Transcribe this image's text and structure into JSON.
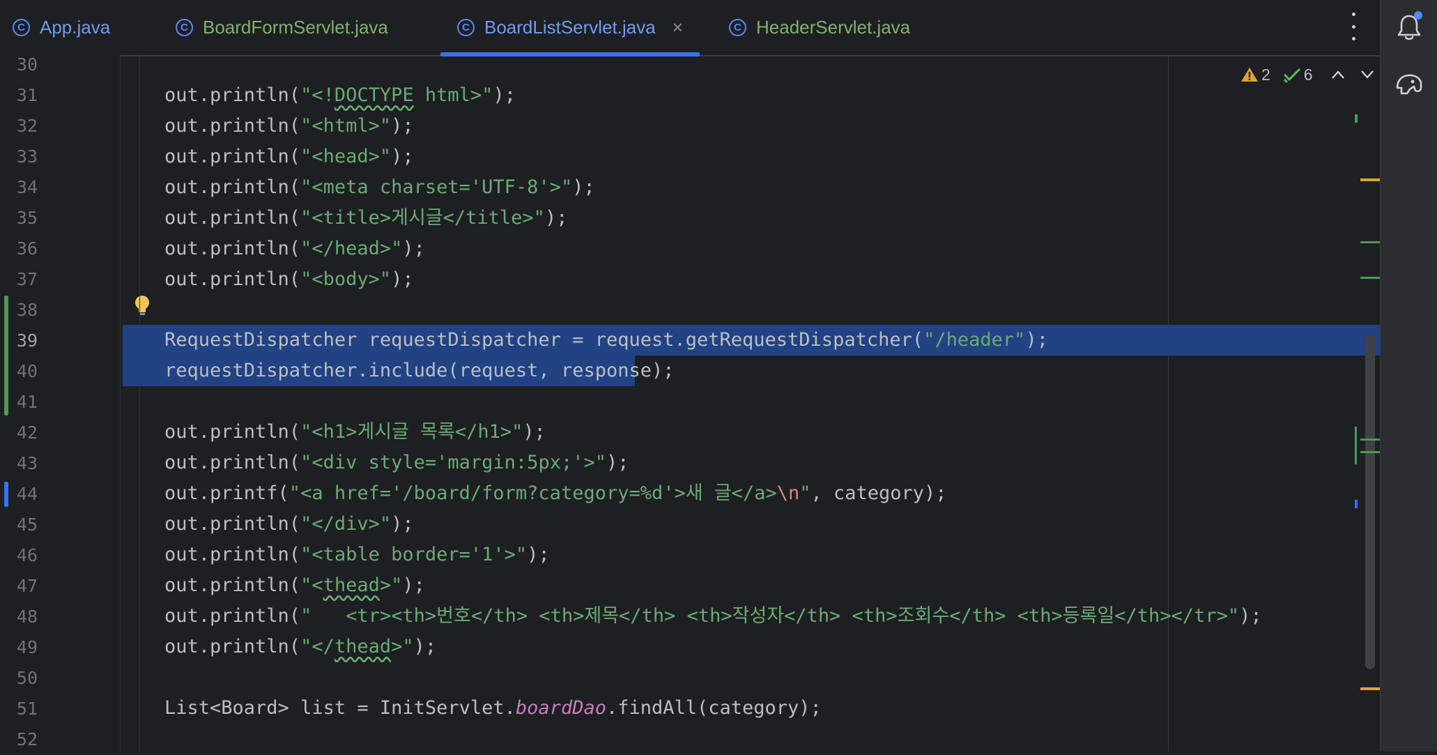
{
  "tabs": [
    {
      "label": "App.java",
      "icon": "java-class-icon",
      "color": "#6f9cf0",
      "active": false,
      "closable": false
    },
    {
      "label": "BoardFormServlet.java",
      "icon": "java-class-icon",
      "color": "#7fb36a",
      "active": false,
      "closable": false
    },
    {
      "label": "BoardListServlet.java",
      "icon": "java-class-icon",
      "color": "#6f9cf0",
      "active": true,
      "closable": true
    },
    {
      "label": "HeaderServlet.java",
      "icon": "java-class-icon",
      "color": "#7fb36a",
      "active": false,
      "closable": false
    }
  ],
  "tab_close_glyph": "×",
  "inspections": {
    "warnings": "2",
    "passed": "6"
  },
  "line_numbers": [
    "30",
    "31",
    "32",
    "33",
    "34",
    "35",
    "36",
    "37",
    "38",
    "39",
    "40",
    "41",
    "42",
    "43",
    "44",
    "45",
    "46",
    "47",
    "48",
    "49",
    "50",
    "51",
    "52"
  ],
  "current_line": "39",
  "code": {
    "l31": {
      "pre": "out.println(",
      "str_a": "\"<!",
      "str_b": "DOCTYPE",
      "str_c": " html>\"",
      "post": ");"
    },
    "l32": {
      "pre": "out.println(",
      "str": "\"<html>\"",
      "post": ");"
    },
    "l33": {
      "pre": "out.println(",
      "str": "\"<head>\"",
      "post": ");"
    },
    "l34": {
      "pre": "out.println(",
      "str": "\"<meta charset='UTF-8'>\"",
      "post": ");"
    },
    "l35": {
      "pre": "out.println(",
      "str": "\"<title>게시글</title>\"",
      "post": ");"
    },
    "l36": {
      "pre": "out.println(",
      "str": "\"</head>\"",
      "post": ");"
    },
    "l37": {
      "pre": "out.println(",
      "str": "\"<body>\"",
      "post": ");"
    },
    "l39": {
      "pre": "RequestDispatcher requestDispatcher = request.getRequestDispatcher(",
      "str": "\"/header\"",
      "post": ");"
    },
    "l40": {
      "text": "requestDispatcher.include(request, response);"
    },
    "l42": {
      "pre": "out.println(",
      "str": "\"<h1>게시글 목록</h1>\"",
      "post": ");"
    },
    "l43": {
      "pre": "out.println(",
      "str": "\"<div style='margin:5px;'>\"",
      "post": ");"
    },
    "l44": {
      "pre": "out.printf(",
      "str": "\"<a href='/board/form?category=%d'>새 글</a>",
      "esc": "\\n",
      "str_end": "\"",
      "post": ", category);"
    },
    "l45": {
      "pre": "out.println(",
      "str": "\"</div>\"",
      "post": ");"
    },
    "l46": {
      "pre": "out.println(",
      "str": "\"<table border='1'>\"",
      "post": ");"
    },
    "l47": {
      "pre": "out.println(",
      "str_a": "\"<",
      "str_b": "thead",
      "str_c": ">\"",
      "post": ");"
    },
    "l48": {
      "pre": "out.println(",
      "str": "\"   <tr><th>번호</th> <th>제목</th> <th>작성자</th> <th>조회수</th> <th>등록일</th></tr>\"",
      "post": ");"
    },
    "l49": {
      "pre": "out.println(",
      "str_a": "\"</",
      "str_b": "thead",
      "str_c": ">\"",
      "post": ");"
    },
    "l51": {
      "pre": "List<Board> list = InitServlet.",
      "field": "boardDao",
      "post": ".findAll(category);"
    }
  },
  "colors": {
    "background": "#1e1f22",
    "string": "#6aab73",
    "escape": "#cf8e6d",
    "static_field": "#c77dbb",
    "selection": "#214283",
    "active_tab_underline": "#3574f0",
    "vcs_added": "#499c54",
    "vcs_modified": "#3574f0",
    "warning": "#e0a32e"
  }
}
